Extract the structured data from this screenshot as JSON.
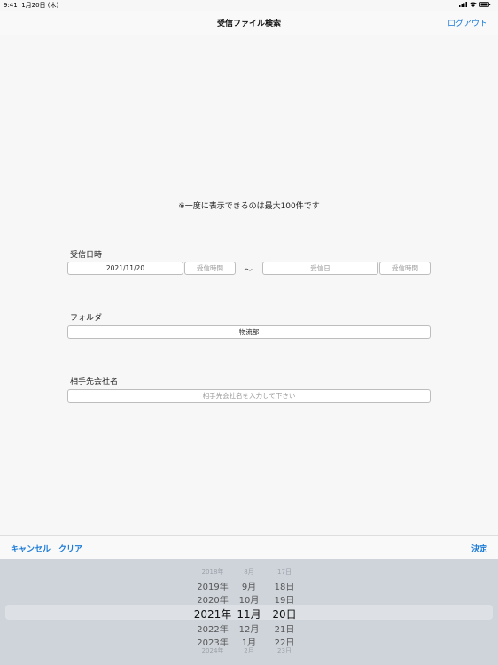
{
  "status_bar": {
    "time": "9:41",
    "date": "1月20日 (木)"
  },
  "navbar": {
    "title": "受信ファイル検索",
    "logout_label": "ログアウト"
  },
  "notice": "※一度に表示できるのは最大100件です",
  "form": {
    "received_datetime_label": "受信日時",
    "start_date_value": "2021/11/20",
    "start_time_placeholder": "受信時間",
    "tilde": "〜",
    "end_date_placeholder": "受信日",
    "end_time_placeholder": "受信時間",
    "folder_label": "フォルダー",
    "folder_value": "物流部",
    "company_label": "相手先会社名",
    "company_placeholder": "相手先会社名を入力して下さい"
  },
  "toolbar": {
    "cancel_label": "キャンセル",
    "clear_label": "クリア",
    "done_label": "決定"
  },
  "picker": {
    "years": [
      "2018年",
      "2019年",
      "2020年",
      "2021年",
      "2022年",
      "2023年",
      "2024年"
    ],
    "months": [
      "8月",
      "9月",
      "10月",
      "11月",
      "12月",
      "1月",
      "2月"
    ],
    "days": [
      "17日",
      "18日",
      "19日",
      "20日",
      "21日",
      "22日",
      "23日"
    ],
    "selected_index": 3
  },
  "colors": {
    "accent": "#1a7ad6"
  }
}
